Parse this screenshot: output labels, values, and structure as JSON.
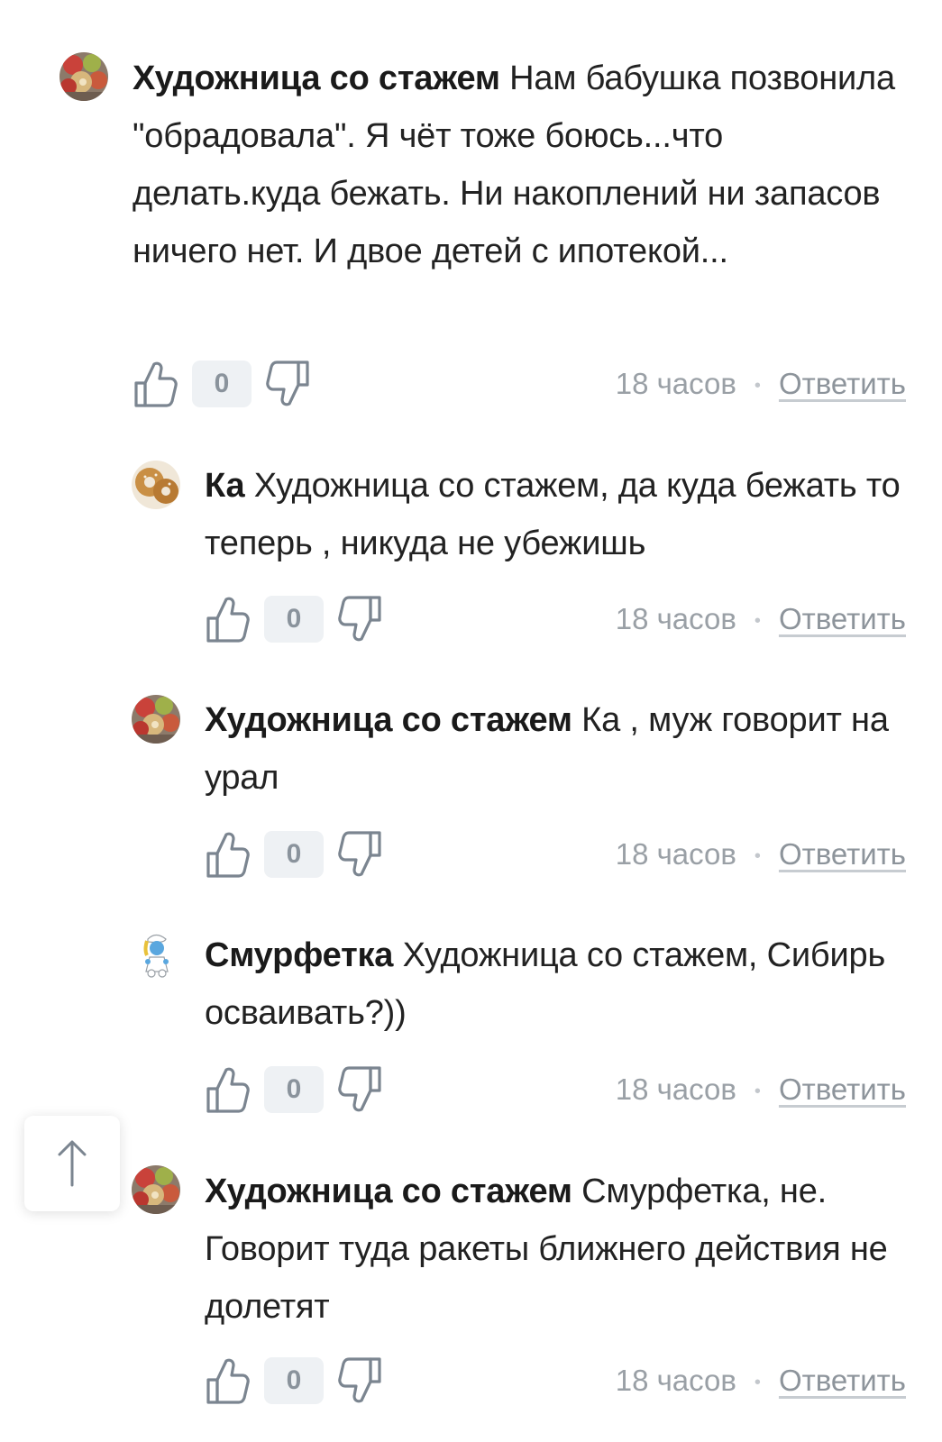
{
  "comments": [
    {
      "author": "Художница со стажем",
      "text": "Нам бабушка позвонила \"обрадовала\". Я чёт тоже боюсь...что делать.куда бежать. Ни накоплений ни запасов ничего нет. И двое детей с ипотекой...",
      "likes": "0",
      "time": "18 часов",
      "reply_label": "Ответить",
      "avatar": "apples-avatar"
    },
    {
      "author": "Ка",
      "text": "Художница со стажем, да куда бежать то теперь , никуда не убежишь",
      "likes": "0",
      "time": "18 часов",
      "reply_label": "Ответить",
      "avatar": "bagels-avatar"
    },
    {
      "author": "Художница со стажем",
      "text": "Ка , муж говорит на урал",
      "likes": "0",
      "time": "18 часов",
      "reply_label": "Ответить",
      "avatar": "apples-avatar"
    },
    {
      "author": "Смурфетка",
      "text": "Художница со стажем, Сибирь осваивать?))",
      "likes": "0",
      "time": "18 часов",
      "reply_label": "Ответить",
      "avatar": "smurfette-avatar"
    },
    {
      "author": "Художница со стажем",
      "text": "Смурфетка, не. Говорит туда ракеты ближнего действия не долетят",
      "likes": "0",
      "time": "18 часов",
      "reply_label": "Ответить",
      "avatar": "apples-avatar"
    }
  ],
  "separator": "•",
  "scroll_top_icon": "arrow-up-icon",
  "colors": {
    "text": "#222222",
    "muted": "#9aa0a6",
    "count_bg": "#eef1f4",
    "icon": "#7b8590"
  }
}
